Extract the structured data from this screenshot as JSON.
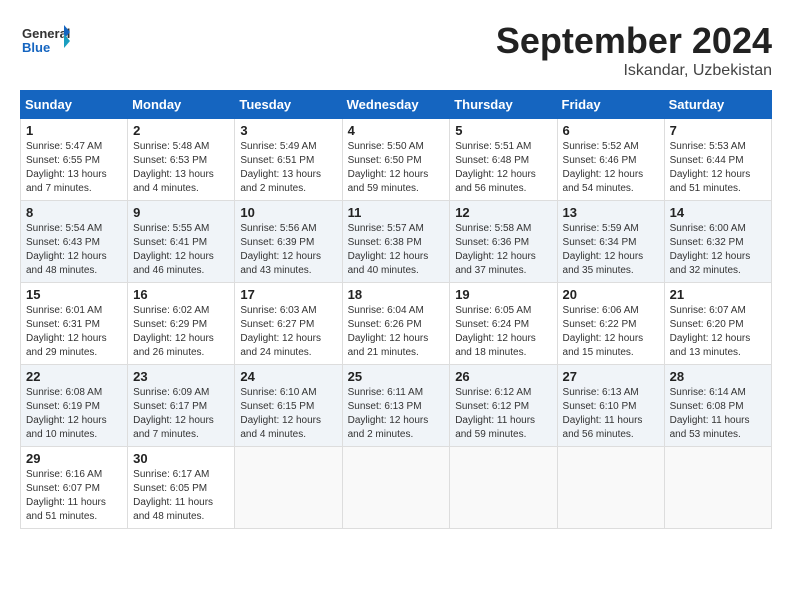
{
  "header": {
    "logo_general": "General",
    "logo_blue": "Blue",
    "month_title": "September 2024",
    "subtitle": "Iskandar, Uzbekistan"
  },
  "calendar": {
    "headers": [
      "Sunday",
      "Monday",
      "Tuesday",
      "Wednesday",
      "Thursday",
      "Friday",
      "Saturday"
    ],
    "weeks": [
      [
        {
          "day": "1",
          "info": "Sunrise: 5:47 AM\nSunset: 6:55 PM\nDaylight: 13 hours and 7 minutes."
        },
        {
          "day": "2",
          "info": "Sunrise: 5:48 AM\nSunset: 6:53 PM\nDaylight: 13 hours and 4 minutes."
        },
        {
          "day": "3",
          "info": "Sunrise: 5:49 AM\nSunset: 6:51 PM\nDaylight: 13 hours and 2 minutes."
        },
        {
          "day": "4",
          "info": "Sunrise: 5:50 AM\nSunset: 6:50 PM\nDaylight: 12 hours and 59 minutes."
        },
        {
          "day": "5",
          "info": "Sunrise: 5:51 AM\nSunset: 6:48 PM\nDaylight: 12 hours and 56 minutes."
        },
        {
          "day": "6",
          "info": "Sunrise: 5:52 AM\nSunset: 6:46 PM\nDaylight: 12 hours and 54 minutes."
        },
        {
          "day": "7",
          "info": "Sunrise: 5:53 AM\nSunset: 6:44 PM\nDaylight: 12 hours and 51 minutes."
        }
      ],
      [
        {
          "day": "8",
          "info": "Sunrise: 5:54 AM\nSunset: 6:43 PM\nDaylight: 12 hours and 48 minutes."
        },
        {
          "day": "9",
          "info": "Sunrise: 5:55 AM\nSunset: 6:41 PM\nDaylight: 12 hours and 46 minutes."
        },
        {
          "day": "10",
          "info": "Sunrise: 5:56 AM\nSunset: 6:39 PM\nDaylight: 12 hours and 43 minutes."
        },
        {
          "day": "11",
          "info": "Sunrise: 5:57 AM\nSunset: 6:38 PM\nDaylight: 12 hours and 40 minutes."
        },
        {
          "day": "12",
          "info": "Sunrise: 5:58 AM\nSunset: 6:36 PM\nDaylight: 12 hours and 37 minutes."
        },
        {
          "day": "13",
          "info": "Sunrise: 5:59 AM\nSunset: 6:34 PM\nDaylight: 12 hours and 35 minutes."
        },
        {
          "day": "14",
          "info": "Sunrise: 6:00 AM\nSunset: 6:32 PM\nDaylight: 12 hours and 32 minutes."
        }
      ],
      [
        {
          "day": "15",
          "info": "Sunrise: 6:01 AM\nSunset: 6:31 PM\nDaylight: 12 hours and 29 minutes."
        },
        {
          "day": "16",
          "info": "Sunrise: 6:02 AM\nSunset: 6:29 PM\nDaylight: 12 hours and 26 minutes."
        },
        {
          "day": "17",
          "info": "Sunrise: 6:03 AM\nSunset: 6:27 PM\nDaylight: 12 hours and 24 minutes."
        },
        {
          "day": "18",
          "info": "Sunrise: 6:04 AM\nSunset: 6:26 PM\nDaylight: 12 hours and 21 minutes."
        },
        {
          "day": "19",
          "info": "Sunrise: 6:05 AM\nSunset: 6:24 PM\nDaylight: 12 hours and 18 minutes."
        },
        {
          "day": "20",
          "info": "Sunrise: 6:06 AM\nSunset: 6:22 PM\nDaylight: 12 hours and 15 minutes."
        },
        {
          "day": "21",
          "info": "Sunrise: 6:07 AM\nSunset: 6:20 PM\nDaylight: 12 hours and 13 minutes."
        }
      ],
      [
        {
          "day": "22",
          "info": "Sunrise: 6:08 AM\nSunset: 6:19 PM\nDaylight: 12 hours and 10 minutes."
        },
        {
          "day": "23",
          "info": "Sunrise: 6:09 AM\nSunset: 6:17 PM\nDaylight: 12 hours and 7 minutes."
        },
        {
          "day": "24",
          "info": "Sunrise: 6:10 AM\nSunset: 6:15 PM\nDaylight: 12 hours and 4 minutes."
        },
        {
          "day": "25",
          "info": "Sunrise: 6:11 AM\nSunset: 6:13 PM\nDaylight: 12 hours and 2 minutes."
        },
        {
          "day": "26",
          "info": "Sunrise: 6:12 AM\nSunset: 6:12 PM\nDaylight: 11 hours and 59 minutes."
        },
        {
          "day": "27",
          "info": "Sunrise: 6:13 AM\nSunset: 6:10 PM\nDaylight: 11 hours and 56 minutes."
        },
        {
          "day": "28",
          "info": "Sunrise: 6:14 AM\nSunset: 6:08 PM\nDaylight: 11 hours and 53 minutes."
        }
      ],
      [
        {
          "day": "29",
          "info": "Sunrise: 6:16 AM\nSunset: 6:07 PM\nDaylight: 11 hours and 51 minutes."
        },
        {
          "day": "30",
          "info": "Sunrise: 6:17 AM\nSunset: 6:05 PM\nDaylight: 11 hours and 48 minutes."
        },
        {
          "day": "",
          "info": ""
        },
        {
          "day": "",
          "info": ""
        },
        {
          "day": "",
          "info": ""
        },
        {
          "day": "",
          "info": ""
        },
        {
          "day": "",
          "info": ""
        }
      ]
    ]
  }
}
